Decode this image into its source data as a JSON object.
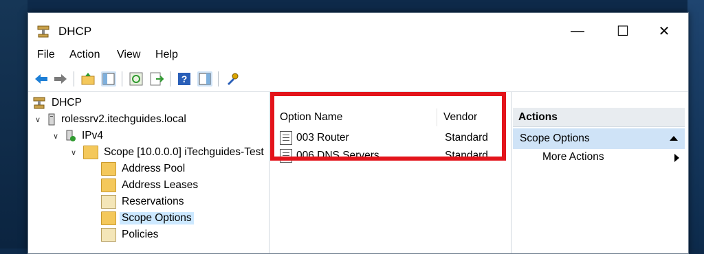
{
  "window": {
    "title": "DHCP",
    "minimize_glyph": "—",
    "maximize_glyph": "☐",
    "close_glyph": "✕"
  },
  "menu": {
    "items": [
      "File",
      "Action",
      "View",
      "Help"
    ]
  },
  "toolbar": {
    "icons": [
      "back-arrow-icon",
      "forward-arrow-icon",
      "up-folder-icon",
      "show-hide-tree-icon",
      "refresh-icon",
      "export-list-icon",
      "help-icon",
      "show-hide-action-pane-icon",
      "tools-icon"
    ]
  },
  "tree": {
    "root": "DHCP",
    "server": "rolessrv2.itechguides.local",
    "ipv4": "IPv4",
    "scope": "Scope [10.0.0.0] iTechguides-Test",
    "children": [
      "Address Pool",
      "Address Leases",
      "Reservations",
      "Scope Options",
      "Policies"
    ],
    "selected": "Scope Options"
  },
  "list": {
    "columns": [
      "Option Name",
      "Vendor"
    ],
    "rows": [
      {
        "name": "003 Router",
        "vendor": "Standard"
      },
      {
        "name": "006 DNS Servers",
        "vendor": "Standard"
      }
    ]
  },
  "actions": {
    "header": "Actions",
    "section": "Scope Options",
    "items": [
      "More Actions"
    ]
  },
  "colors": {
    "highlight": "#e3141b",
    "selection": "#cce8ff",
    "actions_section": "#cfe3f7"
  }
}
